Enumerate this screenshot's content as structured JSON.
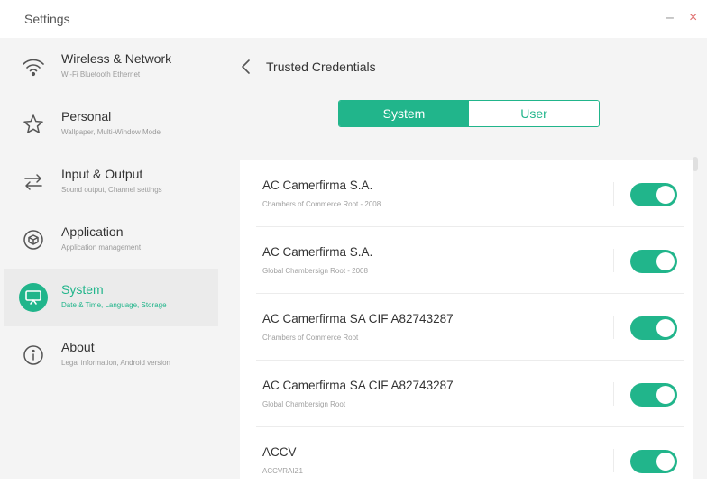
{
  "window": {
    "title": "Settings",
    "minimize": "–",
    "close": "×"
  },
  "sidebar": {
    "items": [
      {
        "icon": "wifi-icon",
        "label": "Wireless & Network",
        "sub": "Wi-Fi Bluetooth Ethernet",
        "active": false
      },
      {
        "icon": "star-icon",
        "label": "Personal",
        "sub": "Wallpaper, Multi-Window Mode",
        "active": false
      },
      {
        "icon": "swap-arrows-icon",
        "label": "Input & Output",
        "sub": "Sound output, Channel settings",
        "active": false
      },
      {
        "icon": "cube-icon",
        "label": "Application",
        "sub": "Application management",
        "active": false
      },
      {
        "icon": "monitor-icon",
        "label": "System",
        "sub": "Date & Time, Language, Storage",
        "active": true
      },
      {
        "icon": "info-icon",
        "label": "About",
        "sub": "Legal information, Android version",
        "active": false
      }
    ]
  },
  "main": {
    "back_icon": "chevron-left-icon",
    "title": "Trusted Credentials",
    "tabs": [
      {
        "label": "System",
        "selected": true
      },
      {
        "label": "User",
        "selected": false
      }
    ],
    "credentials": [
      {
        "name": "AC Camerfirma S.A.",
        "sub": "Chambers of Commerce Root - 2008",
        "enabled": true
      },
      {
        "name": "AC Camerfirma S.A.",
        "sub": "Global Chambersign Root - 2008",
        "enabled": true
      },
      {
        "name": "AC Camerfirma SA CIF A82743287",
        "sub": "Chambers of Commerce Root",
        "enabled": true
      },
      {
        "name": "AC Camerfirma SA CIF A82743287",
        "sub": "Global Chambersign Root",
        "enabled": true
      },
      {
        "name": "ACCV",
        "sub": "ACCVRAIZ1",
        "enabled": true
      }
    ]
  },
  "colors": {
    "accent": "#21b58b",
    "sidebar_bg": "#f4f4f4",
    "list_bg": "#ffffff"
  }
}
